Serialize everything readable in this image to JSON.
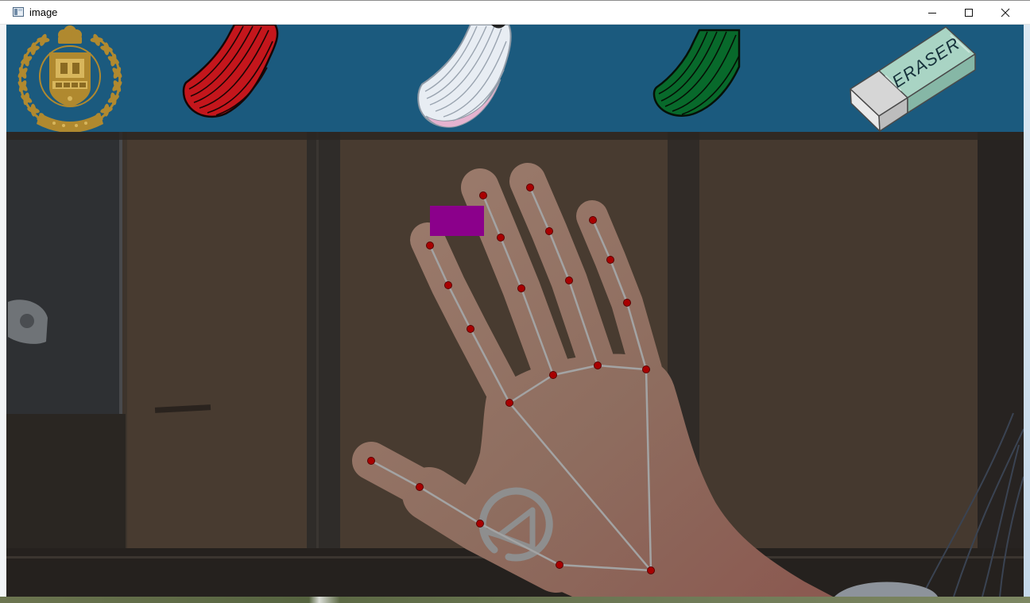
{
  "window": {
    "title": "image",
    "icon": "app-window-icon",
    "controls": [
      "minimize-icon",
      "maximize-icon",
      "close-icon"
    ]
  },
  "toolbar": {
    "background": "#1b5a7e",
    "logo": {
      "icon": "university-seal-logo",
      "color": "#b0892f"
    },
    "tools": [
      {
        "icon": "red-brush-icon",
        "color": "#c4161c"
      },
      {
        "icon": "white-brush-icon",
        "color": "#e8edf3"
      },
      {
        "icon": "green-brush-icon",
        "color": "#08692b"
      },
      {
        "icon": "eraser-icon",
        "label": "ERASER",
        "color": "#a9d4c4"
      }
    ]
  },
  "canvas": {
    "cursor_color": "#8b008b",
    "landmark_point_color": "#a80000",
    "landmark_line_color": "#a3a3a3"
  }
}
